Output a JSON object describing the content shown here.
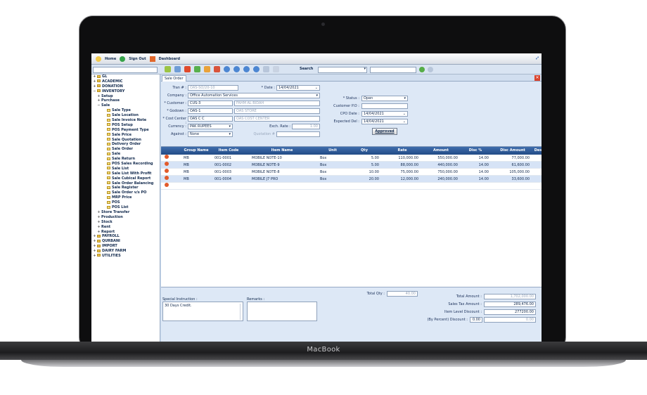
{
  "topbar": {
    "home": "Home",
    "signout": "Sign Out",
    "dashboard": "Dashboard"
  },
  "toolbar": {
    "search_label": "Search"
  },
  "sidebar": {
    "items": [
      {
        "label": "GL",
        "level": 0
      },
      {
        "label": "ACADEMIC",
        "level": 0
      },
      {
        "label": "DONATION",
        "level": 0
      },
      {
        "label": "INVENTORY",
        "level": 0
      },
      {
        "label": "Setup",
        "level": 1
      },
      {
        "label": "Purchase",
        "level": 1
      },
      {
        "label": "Sale",
        "level": 1
      },
      {
        "label": "Sale Type",
        "level": 2
      },
      {
        "label": "Sale Location",
        "level": 2
      },
      {
        "label": "Sale Invoice Note",
        "level": 2
      },
      {
        "label": "POS Setup",
        "level": 2
      },
      {
        "label": "POS Payment Type",
        "level": 2
      },
      {
        "label": "Sale Price",
        "level": 2
      },
      {
        "label": "Sale Quotation",
        "level": 2
      },
      {
        "label": "Delivery Order",
        "level": 2
      },
      {
        "label": "Sale Order",
        "level": 2
      },
      {
        "label": "Sale",
        "level": 2
      },
      {
        "label": "Sale Return",
        "level": 2
      },
      {
        "label": "POS Sales Recording",
        "level": 2
      },
      {
        "label": "Sale List",
        "level": 2
      },
      {
        "label": "Sale List With Profit",
        "level": 2
      },
      {
        "label": "Sale Cubical Report",
        "level": 2
      },
      {
        "label": "Sale Order Balancing",
        "level": 2
      },
      {
        "label": "Sale Register",
        "level": 2
      },
      {
        "label": "Sale Order v/s PO",
        "level": 2
      },
      {
        "label": "MRP Price",
        "level": 2
      },
      {
        "label": "POS",
        "level": 2
      },
      {
        "label": "POS List",
        "level": 2
      },
      {
        "label": "Store Transfer",
        "level": 1
      },
      {
        "label": "Production",
        "level": 1
      },
      {
        "label": "Stock",
        "level": 1
      },
      {
        "label": "Rent",
        "level": 1
      },
      {
        "label": "Report",
        "level": 1
      },
      {
        "label": "PAYROLL",
        "level": 0
      },
      {
        "label": "QURBANI",
        "level": 0
      },
      {
        "label": "IMPORT",
        "level": 0
      },
      {
        "label": "DAIRY FARM",
        "level": 0
      },
      {
        "label": "UTILITIES",
        "level": 0
      }
    ]
  },
  "tab": {
    "label": "Sale Order"
  },
  "form": {
    "tran_label": "Tran # :",
    "tran_value": "OAS-SO/20-10",
    "date_label": "* Date :",
    "date_value": "14/04/2021",
    "company_label": "Company :",
    "company_value": "Office Automation Services",
    "customer_label": "* Customer :",
    "customer_code": "CUS-3",
    "customer_name": "FAHM AL BIDAH",
    "godown_label": "* Godown :",
    "godown_code": "OAS-1",
    "godown_name": "OAS STORE",
    "cost_center_label": "* Cost Center :",
    "cost_center_code": "OAS C C",
    "cost_center_name": "OAS COST CENTER",
    "currency_label": "Currency :",
    "currency_value": "PAK RUPEES",
    "exch_label": "Exch. Rate :",
    "exch_value": "1.00",
    "against_label": "Against :",
    "against_value": "None",
    "quotation_label": "Quotation #",
    "status_label": "* Status :",
    "status_value": "Open",
    "customer_po_label": "Customer P.O :",
    "customer_po_value": "",
    "cpo_date_label": "CPO Date :",
    "cpo_date_value": "14/04/2021",
    "expected_del_label": "Expected Del :",
    "expected_del_value": "14/04/2021",
    "approved_button": "Approved"
  },
  "grid": {
    "columns": [
      "Group Name",
      "Item Code",
      "Item Name",
      "Unit",
      "Qty",
      "Rate",
      "Amount",
      "Disc %",
      "Disc Amount",
      "Des"
    ],
    "rows": [
      [
        "MB",
        "001-0001",
        "MOBILE NOTE-10",
        "Box",
        "5.00",
        "110,000.00",
        "550,000.00",
        "14.00",
        "77,000.00"
      ],
      [
        "MB",
        "001-0002",
        "MOBILE NOTE-9",
        "Box",
        "5.00",
        "88,000.00",
        "440,000.00",
        "14.00",
        "61,600.00"
      ],
      [
        "MB",
        "001-0003",
        "MOBILE NOTE-8",
        "Box",
        "10.00",
        "75,000.00",
        "750,000.00",
        "14.00",
        "105,000.00"
      ],
      [
        "MB",
        "001-0004",
        "MOBILE J7 PRO",
        "Box",
        "20.00",
        "12,000.00",
        "240,000.00",
        "14.00",
        "33,600.00"
      ]
    ]
  },
  "footer": {
    "special_label": "Special Instruction :",
    "special_value": "30 Days Credit.",
    "remarks_label": "Remarks :",
    "total_qty_label": "Total Qty :",
    "total_qty_value": "40.00",
    "total_amount_label": "Total Amount :",
    "total_amount_value": "1,702,000.00",
    "sales_tax_label": "Sales Tax Amount :",
    "sales_tax_value": "289,476.00",
    "item_disc_label": "Item Level Discount :",
    "item_disc_value": "277200.00",
    "by_percent_label": "(By Percent) Discount :",
    "by_percent_pct": "0.00",
    "by_percent_value": "0.00"
  },
  "device": {
    "brand": "MacBook"
  }
}
